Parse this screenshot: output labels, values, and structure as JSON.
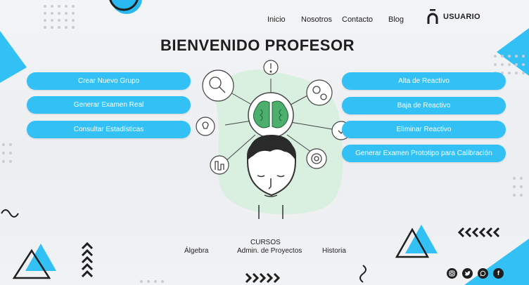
{
  "nav": {
    "items": [
      "Inicio",
      "Nosotros",
      "Contacto",
      "Blog"
    ],
    "user_label": "USUARIO"
  },
  "header": {
    "title": "BIENVENIDO PROFESOR"
  },
  "actions": {
    "left": [
      "Crear Nuevo Grupo",
      "Generar Examen Real",
      "Consultar Estadísticas"
    ],
    "right": [
      "Alta de Reactivo",
      "Baja de Reactivo",
      "Eliminar Reactivo",
      "Generar Examen Prototipo para Calibración"
    ]
  },
  "courses": {
    "title": "CURSOS",
    "items": [
      "Álgebra",
      "Admin. de Proyectos",
      "Historia"
    ]
  },
  "social": [
    "instagram-icon",
    "twitter-icon",
    "whatsapp-icon",
    "facebook-icon"
  ],
  "colors": {
    "accent": "#33c1f5",
    "illustration_bg": "#d9efdf",
    "dark": "#1e1e1e"
  }
}
